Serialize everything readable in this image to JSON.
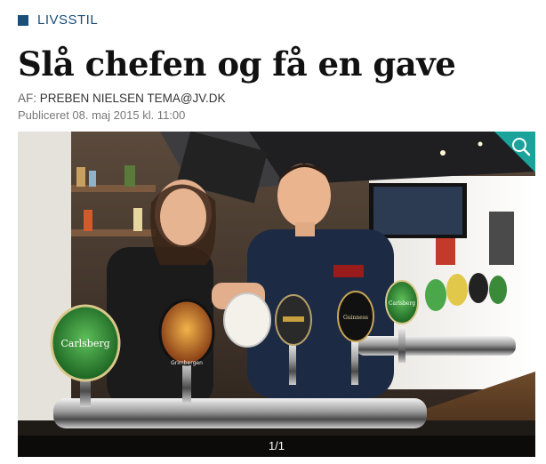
{
  "category": {
    "label": "LIVSSTIL",
    "color": "#1a4e7a"
  },
  "article": {
    "title": "Slå chefen og få en gave",
    "byline_prefix": "AF:",
    "byline_text": "PREBEN NIELSEN TEMA@JV.DK",
    "published": "Publiceret 08. maj 2015 kl. 11:00"
  },
  "gallery": {
    "counter": "1/1",
    "zoom_icon": "magnifier-icon",
    "accent_color": "#1aa39a"
  },
  "tap_labels": [
    "Carlsberg",
    "Grimbergen",
    "Guinness",
    "Carlsberg"
  ]
}
